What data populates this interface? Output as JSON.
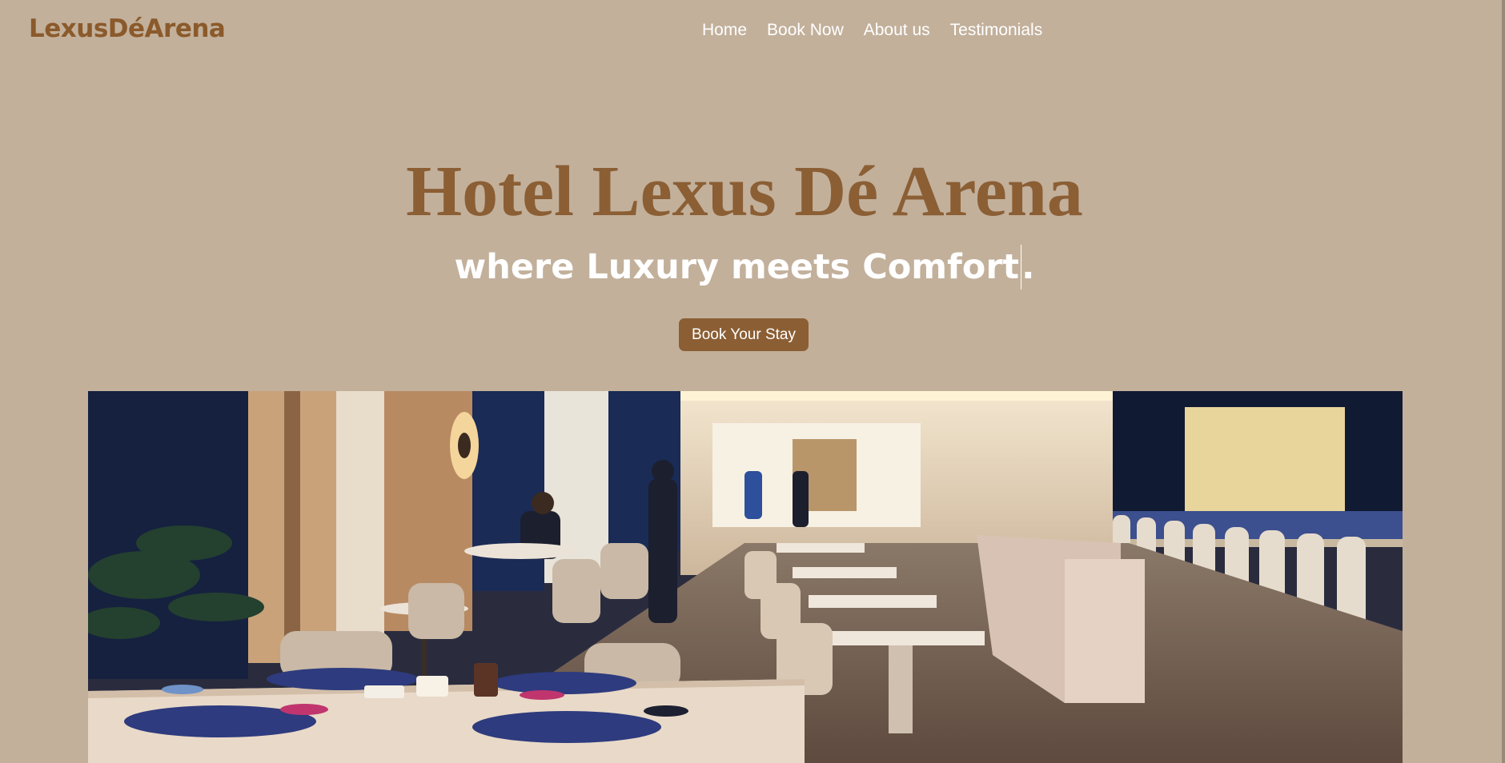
{
  "brand": {
    "logo_text": "LexusDéArena"
  },
  "nav": {
    "items": [
      {
        "label": "Home"
      },
      {
        "label": "Book Now"
      },
      {
        "label": "About us"
      },
      {
        "label": "Testimonials"
      }
    ]
  },
  "hero": {
    "title": "Hotel Lexus Dé Arena",
    "tagline_typed": "where Luxury meets Comfort",
    "tagline_end": ".",
    "cta_label": "Book Your Stay"
  },
  "colors": {
    "background": "#c2b09b",
    "accent": "#8b5e34",
    "logo": "#8b5a2b",
    "nav_text": "#ffffff"
  }
}
